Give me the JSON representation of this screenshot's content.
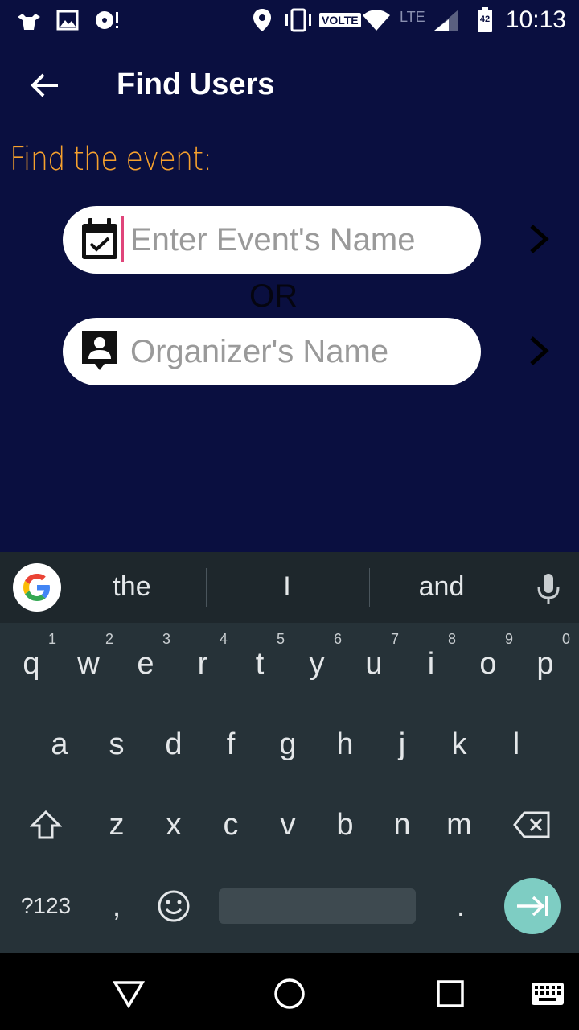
{
  "status_bar": {
    "time": "10:13",
    "volte": "VOLTE",
    "network": "LTE",
    "battery": "42",
    "icons": [
      "accessibility-icon",
      "image-icon",
      "disc-icon",
      "location-icon",
      "vibrate-icon",
      "wifi-icon",
      "signal-icon",
      "battery-icon"
    ]
  },
  "app_bar": {
    "title": "Find Users",
    "back_icon": "arrow-left-icon"
  },
  "section_label": "Find the event:",
  "event_field": {
    "placeholder": "Enter Event's Name",
    "value": "",
    "icon": "calendar-check-icon"
  },
  "or_text": "OR",
  "organizer_field": {
    "placeholder": "Organizer's Name",
    "value": "",
    "icon": "contact-icon"
  },
  "keyboard": {
    "suggestions": [
      "the",
      "I",
      "and"
    ],
    "row1": [
      {
        "k": "q",
        "h": "1"
      },
      {
        "k": "w",
        "h": "2"
      },
      {
        "k": "e",
        "h": "3"
      },
      {
        "k": "r",
        "h": "4"
      },
      {
        "k": "t",
        "h": "5"
      },
      {
        "k": "y",
        "h": "6"
      },
      {
        "k": "u",
        "h": "7"
      },
      {
        "k": "i",
        "h": "8"
      },
      {
        "k": "o",
        "h": "9"
      },
      {
        "k": "p",
        "h": "0"
      }
    ],
    "row2": [
      "a",
      "s",
      "d",
      "f",
      "g",
      "h",
      "j",
      "k",
      "l"
    ],
    "row3": [
      "z",
      "x",
      "c",
      "v",
      "b",
      "n",
      "m"
    ],
    "symbols_label": "?123",
    "comma": ",",
    "period": "."
  },
  "colors": {
    "background": "#0a0f40",
    "accent": "#f6a12d",
    "keyboard": "#263238",
    "enter": "#7ecdc3"
  }
}
